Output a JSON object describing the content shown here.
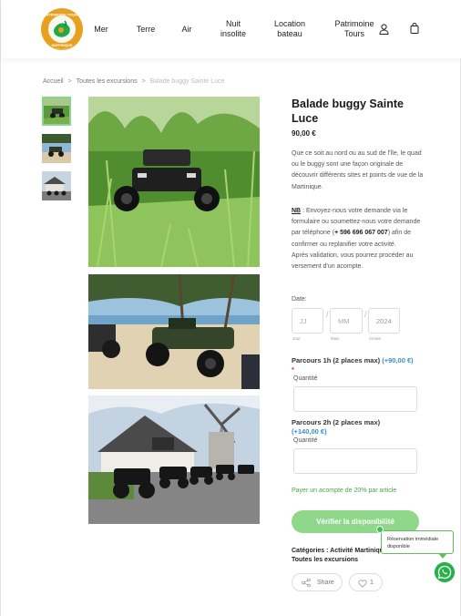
{
  "brand": {
    "logo_text": "PATRIMOINE TOURS MARTINIQUE"
  },
  "nav": {
    "items": [
      {
        "label": "Mer"
      },
      {
        "label": "Terre"
      },
      {
        "label": "Air"
      },
      {
        "label": "Nuit\ninsolite"
      },
      {
        "label": "Location\nbateau"
      },
      {
        "label": "Patrimoine\nTours"
      }
    ]
  },
  "breadcrumb": {
    "home": "Accueil",
    "parent": "Toutes les excursions",
    "current": "Balade buggy Sainte Luce"
  },
  "product": {
    "title": "Balade buggy Sainte Luce",
    "price": "90,00 €",
    "description": "Que ce soit au nord ou au sud de l'île, le quad ou le buggy sont une façon originale de découvrir différents sites et points de vue de la Martinique.",
    "note_label": "NB",
    "note_text_1": " : Envoyez-nous votre demande via le formulaire ou soumettez-nous votre demande par téléphone (",
    "note_phone": "+ 596 696 067 007",
    "note_text_2": ") afin de confirmer ou replanifier votre activité.",
    "note_after": "Après validation, vous pourrez procéder au versement d'un acompte."
  },
  "booking": {
    "date_label": "Date:",
    "day_placeholder": "JJ",
    "month_placeholder": "MM",
    "year_value": "2024",
    "day_sub": "Jour",
    "month_sub": "Mois",
    "year_sub": "Année",
    "option1_title": "Parcours 1h (2 places max)",
    "option1_price": "(+90,00 €)",
    "option1_required": "*",
    "option1_qty_label": "Quantité",
    "option2_title": "Parcours 2h (2 places max)",
    "option2_price": "(+140,00 €)",
    "option2_qty_label": "Quantité",
    "deposit_note": "Payer un acompte de 20% par article",
    "check_button": "Vérifier la disponibilité",
    "categories": "Catégories : Activité Martinique, Toutes les excursions",
    "share_label": "Share",
    "like_count": "1"
  },
  "widget": {
    "tooltip": "Réservation immédiate disponible"
  },
  "colors": {
    "accent_green": "#8fd88a",
    "price_blue": "#3a8fc9",
    "whatsapp": "#27b14a"
  },
  "icons": [
    "user-icon",
    "cart-icon",
    "share-icon",
    "heart-icon",
    "whatsapp-icon"
  ]
}
